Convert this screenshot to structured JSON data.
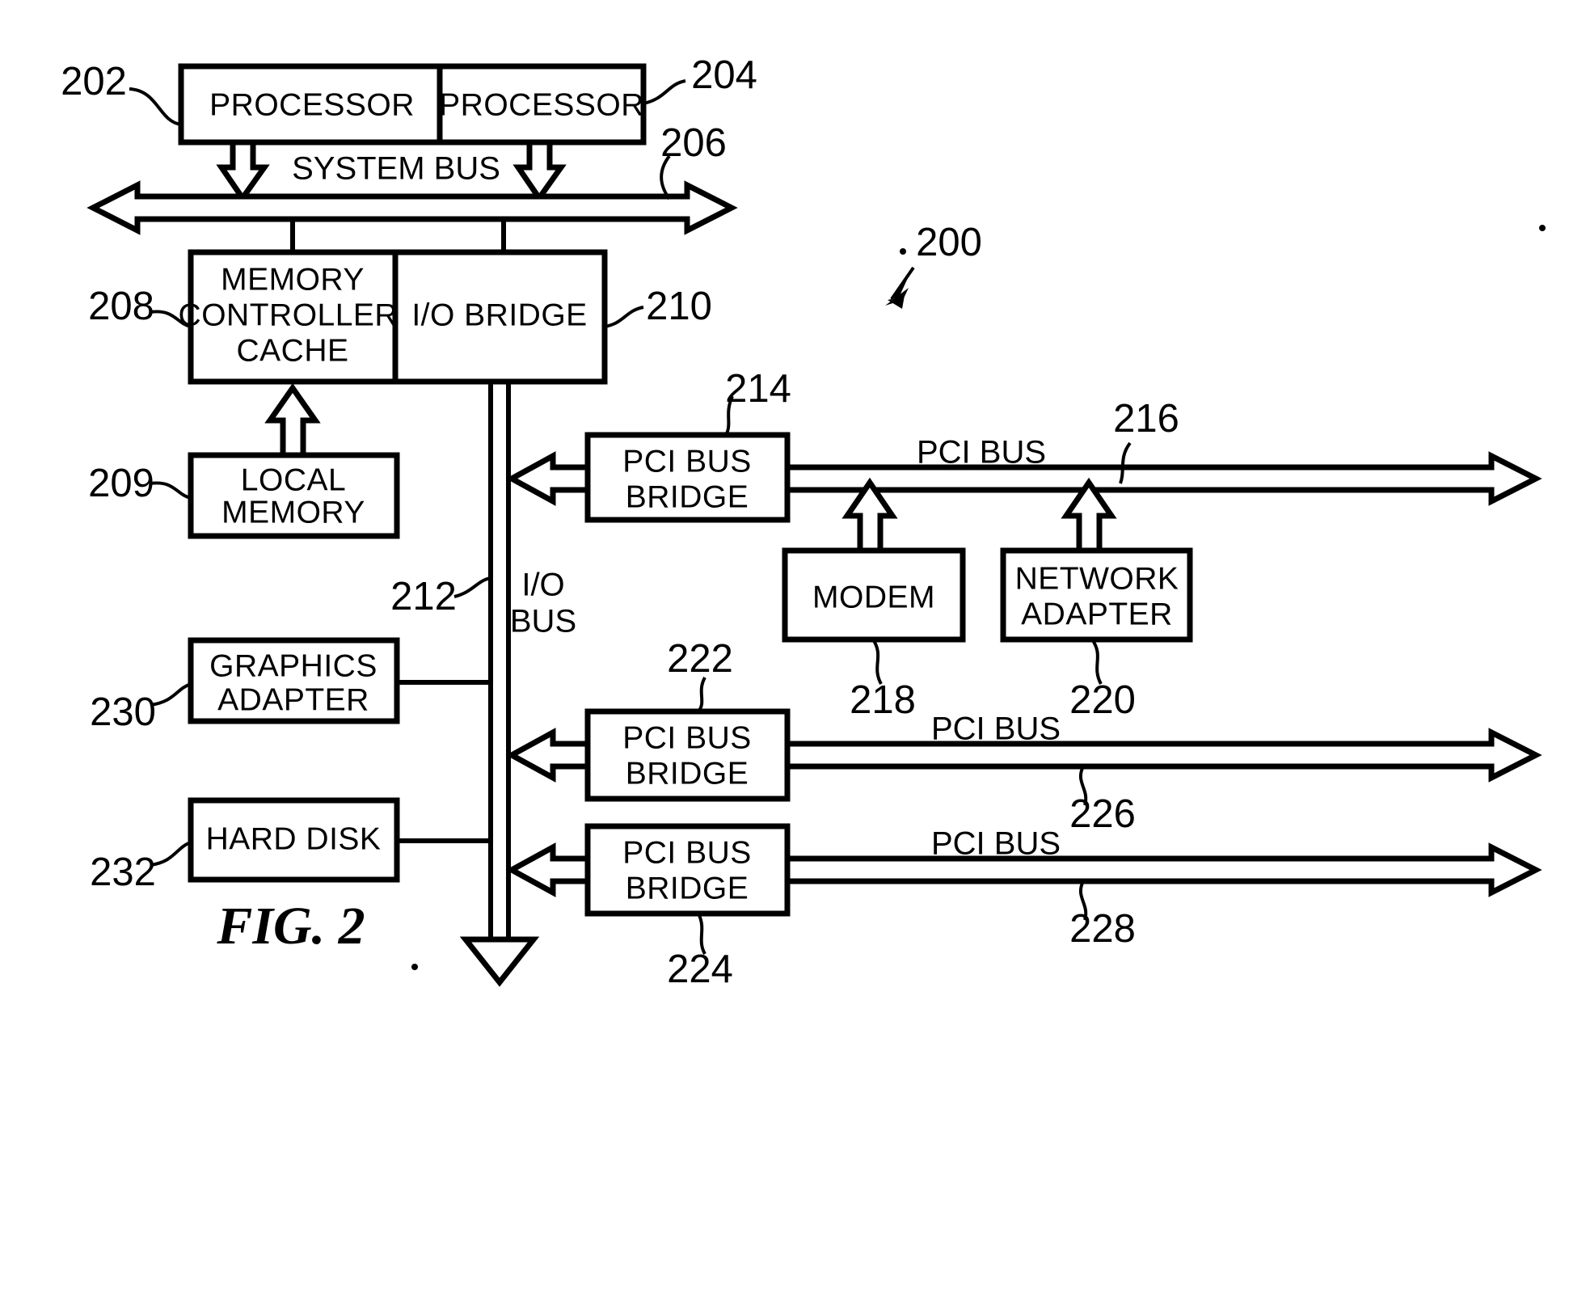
{
  "figure": {
    "caption": "FIG. 2",
    "system_ref": "200"
  },
  "blocks": [
    {
      "id": "processor-1",
      "label_line1": "PROCESSOR",
      "ref": "202"
    },
    {
      "id": "processor-2",
      "label_line1": "PROCESSOR",
      "ref": "204"
    },
    {
      "id": "memory-controller-cache",
      "label_line1": "MEMORY",
      "label_line2": "CONTROLLER/",
      "label_line3": "CACHE",
      "ref": "208"
    },
    {
      "id": "io-bridge",
      "label_line1": "I/O BRIDGE",
      "ref": "210"
    },
    {
      "id": "local-memory",
      "label_line1": "LOCAL",
      "label_line2": "MEMORY",
      "ref": "209"
    },
    {
      "id": "pci-bus-bridge-1",
      "label_line1": "PCI BUS",
      "label_line2": "BRIDGE",
      "ref": "214"
    },
    {
      "id": "pci-bus-bridge-2",
      "label_line1": "PCI BUS",
      "label_line2": "BRIDGE",
      "ref": "222"
    },
    {
      "id": "pci-bus-bridge-3",
      "label_line1": "PCI BUS",
      "label_line2": "BRIDGE",
      "ref": "224"
    },
    {
      "id": "modem",
      "label_line1": "MODEM",
      "ref": "218"
    },
    {
      "id": "network-adapter",
      "label_line1": "NETWORK",
      "label_line2": "ADAPTER",
      "ref": "220"
    },
    {
      "id": "graphics-adapter",
      "label_line1": "GRAPHICS",
      "label_line2": "ADAPTER",
      "ref": "230"
    },
    {
      "id": "hard-disk",
      "label_line1": "HARD DISK",
      "ref": "232"
    }
  ],
  "buses": [
    {
      "id": "system-bus",
      "label": "SYSTEM BUS",
      "ref": "206"
    },
    {
      "id": "io-bus",
      "label_line1": "I/O",
      "label_line2": "BUS",
      "ref": "212"
    },
    {
      "id": "pci-bus-1",
      "label": "PCI BUS",
      "ref": "216"
    },
    {
      "id": "pci-bus-2",
      "label": "PCI BUS",
      "ref": "226"
    },
    {
      "id": "pci-bus-3",
      "label": "PCI BUS",
      "ref": "228"
    }
  ],
  "labels": {
    "processor_1": "PROCESSOR",
    "processor_2": "PROCESSOR",
    "mem_ctrl_l1": "MEMORY",
    "mem_ctrl_l2": "CONTROLLER/",
    "mem_ctrl_l3": "CACHE",
    "io_bridge": "I/O BRIDGE",
    "local_mem_l1": "LOCAL",
    "local_mem_l2": "MEMORY",
    "pci_bridge_l1": "PCI BUS",
    "pci_bridge_l2": "BRIDGE",
    "modem": "MODEM",
    "netadapter_l1": "NETWORK",
    "netadapter_l2": "ADAPTER",
    "graphics_l1": "GRAPHICS",
    "graphics_l2": "ADAPTER",
    "hard_disk": "HARD DISK",
    "system_bus": "SYSTEM BUS",
    "io_bus_l1": "I/O",
    "io_bus_l2": "BUS",
    "pci_bus": "PCI BUS",
    "fig_caption": "FIG. 2"
  },
  "refs": {
    "r200": "200",
    "r202": "202",
    "r204": "204",
    "r206": "206",
    "r208": "208",
    "r209": "209",
    "r210": "210",
    "r212": "212",
    "r214": "214",
    "r216": "216",
    "r218": "218",
    "r220": "220",
    "r222": "222",
    "r224": "224",
    "r226": "226",
    "r228": "228",
    "r230": "230",
    "r232": "232"
  },
  "colors": {
    "ink": "#000000",
    "paper": "#ffffff"
  }
}
